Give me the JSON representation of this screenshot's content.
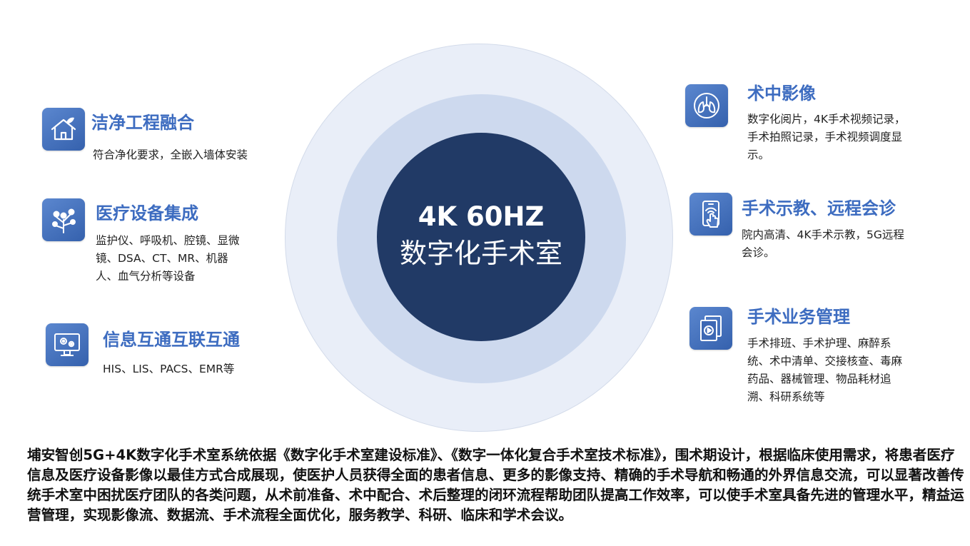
{
  "center": {
    "title": "4K 60HZ",
    "subtitle": "数字化手术室"
  },
  "features": {
    "clean": {
      "icon": "house-leaf-icon",
      "title": "洁净工程融合",
      "desc": "符合净化要求，全嵌入墙体安装"
    },
    "device": {
      "icon": "network-tree-icon",
      "title": "医疗设备集成",
      "desc": "监护仪、呼吸机、腔镜、显微镜、DSA、CT、MR、机器人、血气分析等设备"
    },
    "info": {
      "icon": "monitor-gears-icon",
      "title": "信息互通互联互通",
      "desc": "HIS、LIS、PACS、EMR等"
    },
    "imaging": {
      "icon": "lungs-icon",
      "title": "术中影像",
      "desc": "数字化阅片，4K手术视频记录，手术拍照记录，手术视频调度显示。"
    },
    "teaching": {
      "icon": "phone-touch-icon",
      "title": "手术示教、远程会诊",
      "desc": "院内高清、4K手术示教，5G远程会诊。"
    },
    "management": {
      "icon": "video-folder-icon",
      "title": "手术业务管理",
      "desc": "手术排班、手术护理、麻醉系统、术中清单、交接核查、毒麻药品、器械管理、物品耗材追溯、科研系统等"
    }
  },
  "summary": "埔安智创5G+4K数字化手术室系统依据《数字化手术室建设标准》、《数字一体化复合手术室技术标准》，围术期设计，根据临床使用需求，将患者医疗信息及医疗设备影像以最佳方式合成展现，使医护人员获得全面的患者信息、更多的影像支持、精确的手术导航和畅通的外界信息交流，可以显著改善传统手术室中困扰医疗团队的各类问题，从术前准备、术中配合、术后整理的闭环流程帮助团队提高工作效率，可以使手术室具备先进的管理水平，精益运营管理，实现影像流、数据流、手术流程全面优化，服务教学、科研、临床和学术会议。",
  "colors": {
    "core": "#213a66",
    "accent": "#3d6cc0",
    "ring_mid": "#cdd9ee",
    "ring_outer": "#e9eef8"
  }
}
